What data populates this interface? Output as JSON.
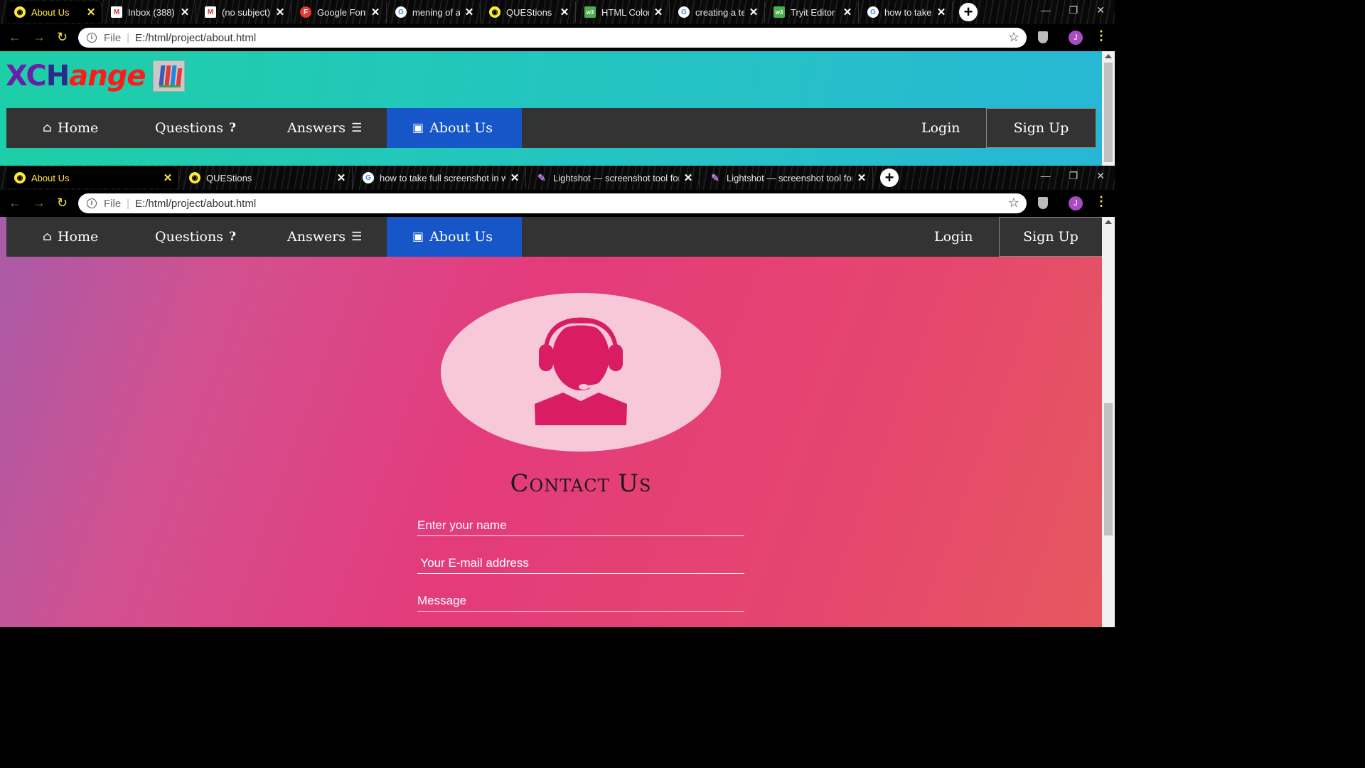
{
  "window1": {
    "tabs": [
      {
        "title": "About Us",
        "favicon": "globe-icon",
        "active": true
      },
      {
        "title": "Inbox (388) -",
        "favicon": "gmail-icon",
        "active": false
      },
      {
        "title": "(no subject) -",
        "favicon": "gmail-icon",
        "active": false
      },
      {
        "title": "Google Fonts",
        "favicon": "google-fonts-icon",
        "active": false
      },
      {
        "title": "mening of ar",
        "favicon": "google-icon",
        "active": false
      },
      {
        "title": "QUEStions",
        "favicon": "globe-icon",
        "active": false
      },
      {
        "title": "HTML Color",
        "favicon": "w3schools-icon",
        "active": false
      },
      {
        "title": "creating a te",
        "favicon": "google-icon",
        "active": false
      },
      {
        "title": "Tryit Editor",
        "favicon": "w3schools-icon",
        "active": false
      },
      {
        "title": "how to take",
        "favicon": "google-icon",
        "active": false
      }
    ],
    "address": {
      "scheme": "File",
      "url": "E:/html/project/about.html"
    },
    "avatar_initial": "J"
  },
  "window2": {
    "tabs": [
      {
        "title": "About Us",
        "favicon": "globe-icon",
        "active": true
      },
      {
        "title": "QUEStions",
        "favicon": "globe-icon",
        "active": false
      },
      {
        "title": "how to take full screenshot in wi",
        "favicon": "google-icon",
        "active": false
      },
      {
        "title": "Lightshot — screenshot tool for M",
        "favicon": "feather-icon",
        "active": false
      },
      {
        "title": "Lightshot — screenshot tool for M",
        "favicon": "feather-icon",
        "active": false
      }
    ],
    "address": {
      "scheme": "File",
      "url": "E:/html/project/about.html"
    },
    "avatar_initial": "J"
  },
  "site": {
    "logo": {
      "part1": "XC",
      "part2": "H",
      "part3": "ange"
    },
    "nav": {
      "home": "Home",
      "questions": "Questions",
      "answers": "Answers",
      "about": "About Us",
      "login": "Login",
      "signup": "Sign Up"
    },
    "contact": {
      "title": "Contact Us",
      "name_placeholder": "Enter your name",
      "email_placeholder": " Your E-mail address",
      "message_placeholder": "Message"
    }
  },
  "colors": {
    "nav_bg": "#333333",
    "nav_active": "#1656c8",
    "header_gradient_start": "#1dcfa7",
    "header_gradient_end": "#27b7d5",
    "contact_gradient_main": "#e43b7c",
    "support_icon": "#d91c63",
    "active_tab_text": "#ffeb3b"
  }
}
